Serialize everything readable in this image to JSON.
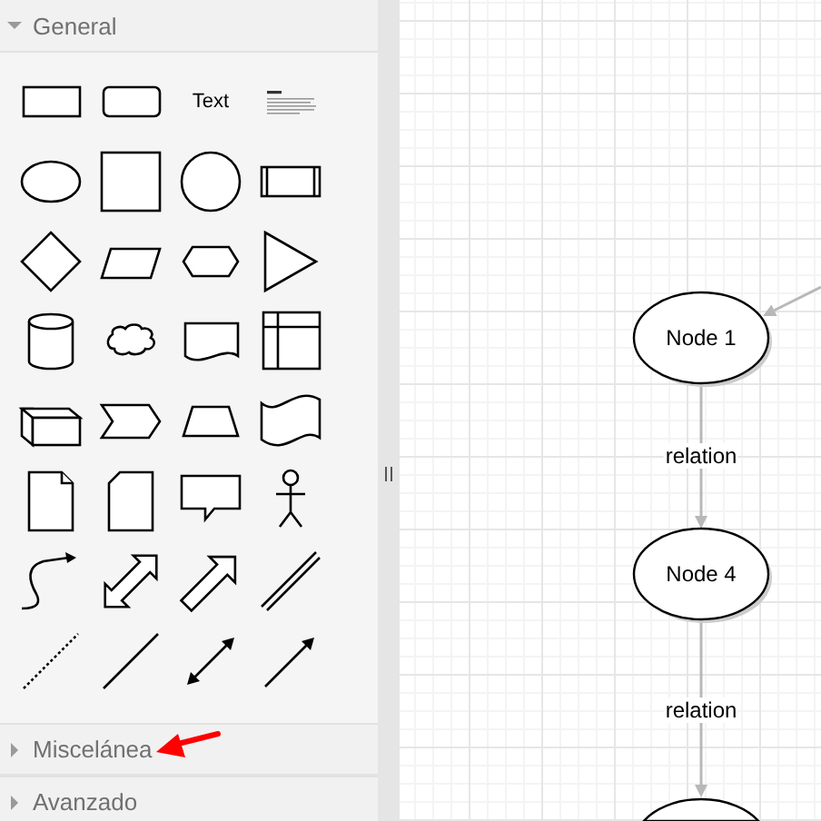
{
  "sidebar": {
    "sections": [
      {
        "title": "General",
        "expanded": true,
        "shapes": [
          {
            "kind": "rectangle"
          },
          {
            "kind": "rounded-rectangle"
          },
          {
            "kind": "text",
            "label": "Text"
          },
          {
            "kind": "textbox"
          },
          {
            "kind": "ellipse"
          },
          {
            "kind": "square"
          },
          {
            "kind": "circle"
          },
          {
            "kind": "process"
          },
          {
            "kind": "diamond"
          },
          {
            "kind": "parallelogram"
          },
          {
            "kind": "hexagon"
          },
          {
            "kind": "triangle"
          },
          {
            "kind": "cylinder"
          },
          {
            "kind": "cloud"
          },
          {
            "kind": "document"
          },
          {
            "kind": "internal-storage"
          },
          {
            "kind": "cube"
          },
          {
            "kind": "step"
          },
          {
            "kind": "trapezoid"
          },
          {
            "kind": "tape"
          },
          {
            "kind": "note"
          },
          {
            "kind": "card"
          },
          {
            "kind": "callout"
          },
          {
            "kind": "actor"
          },
          {
            "kind": "curve"
          },
          {
            "kind": "double-arrow"
          },
          {
            "kind": "arrow"
          },
          {
            "kind": "link"
          },
          {
            "kind": "dotted-line"
          },
          {
            "kind": "line"
          },
          {
            "kind": "double-connector"
          },
          {
            "kind": "connector"
          }
        ]
      },
      {
        "title": "Miscelánea",
        "expanded": false
      },
      {
        "title": "Avanzado",
        "expanded": false
      }
    ],
    "annotations": [
      {
        "kind": "arrow"
      }
    ]
  },
  "diagram": {
    "nodes": [
      {
        "kind": "ellipse",
        "label": "Node 1"
      },
      {
        "kind": "ellipse",
        "label": "Node 4"
      },
      {
        "kind": "ellipse"
      }
    ],
    "edges": [
      {
        "kind": "arrow"
      },
      {
        "kind": "arrow",
        "label": "relation"
      },
      {
        "kind": "arrow",
        "label": "relation"
      }
    ]
  }
}
